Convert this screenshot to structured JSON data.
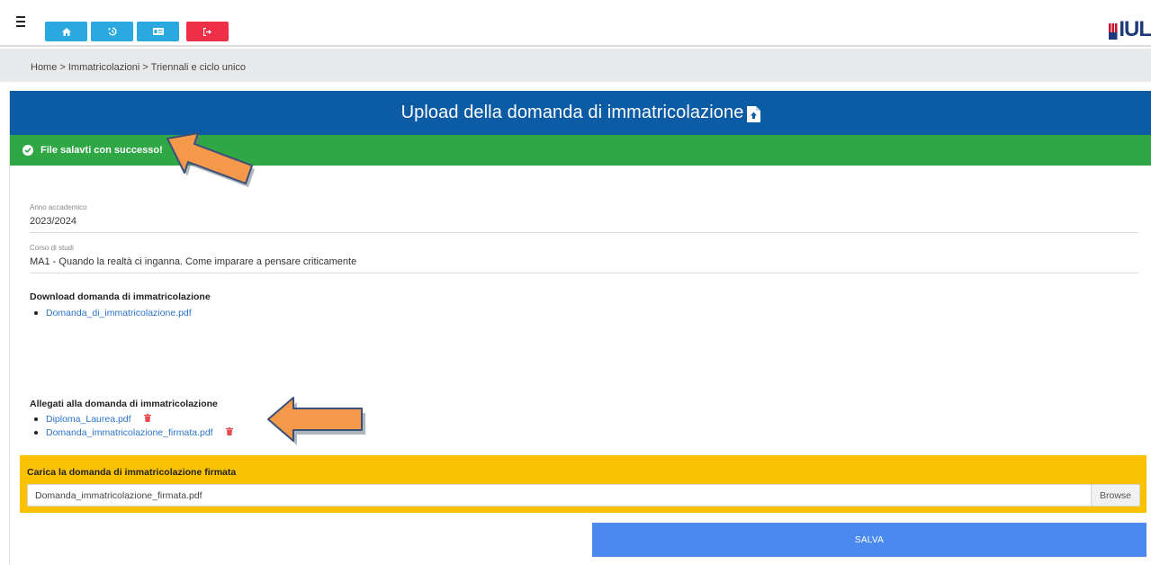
{
  "topbar": {
    "menu_icon": "hamburger-icon",
    "buttons": [
      {
        "icon": "home-icon",
        "color": "#2aa8e0"
      },
      {
        "icon": "history-icon",
        "color": "#2aa8e0"
      },
      {
        "icon": "id-card-icon",
        "color": "#2aa8e0"
      },
      {
        "icon": "logout-icon",
        "color": "#ee2f48"
      }
    ],
    "logo_text": "IUL"
  },
  "breadcrumb": "Home > Immatricolazioni > Triennali e ciclo unico",
  "card": {
    "title": "Upload della domanda di immatricolazione",
    "header_color": "#0b5ba5",
    "alert": {
      "text": "File salavti con successo!",
      "color": "#2fa744"
    },
    "fields": [
      {
        "label": "Anno accademico",
        "value": "2023/2024"
      },
      {
        "label": "Corso di studi",
        "value": "MA1 - Quando la realtà ci inganna. Come imparare a pensare criticamente"
      }
    ],
    "download": {
      "title": "Download domanda di immatricolazione",
      "files": [
        "Domanda_di_immatricolazione.pdf"
      ]
    },
    "attachments": {
      "title": "Allegati alla domanda di immatricolazione",
      "files": [
        "Diploma_Laurea.pdf",
        "Domanda_immatricolazione_firmata.pdf"
      ]
    },
    "upload": {
      "label": "Carica la domanda di immatricolazione firmata",
      "file_name": "Domanda_immatricolazione_firmata.pdf",
      "browse_label": "Browse",
      "color": "#fbc103"
    },
    "save_label": "SALVA"
  }
}
